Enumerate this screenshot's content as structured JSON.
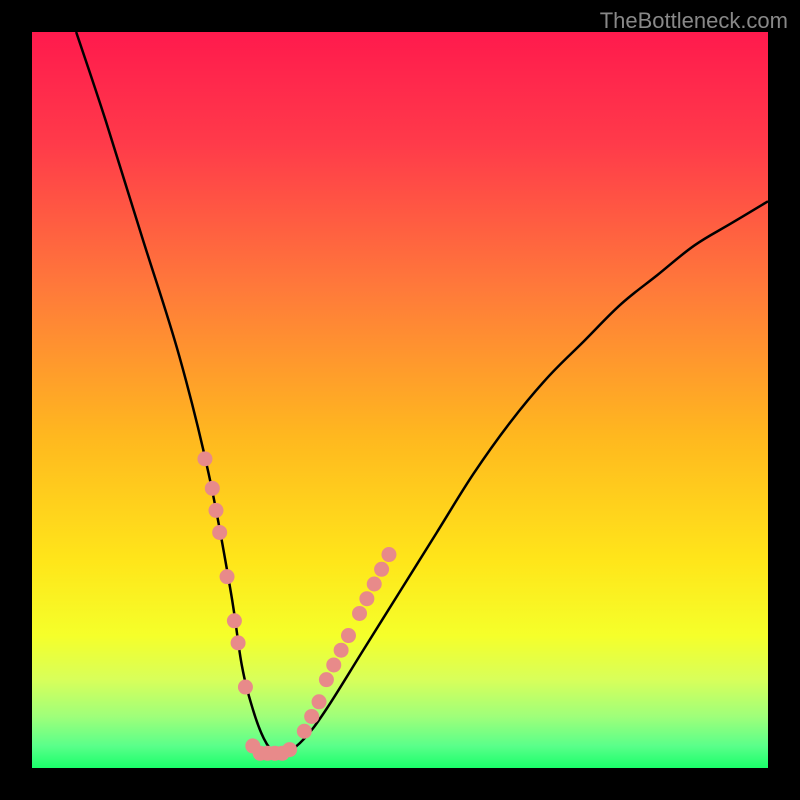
{
  "watermark": "TheBottleneck.com",
  "chart_data": {
    "type": "line",
    "title": "",
    "xlabel": "",
    "ylabel": "",
    "xlim": [
      0,
      100
    ],
    "ylim": [
      0,
      100
    ],
    "series": [
      {
        "name": "bottleneck-curve",
        "x": [
          6,
          10,
          15,
          20,
          24,
          27,
          28.5,
          30,
          31.5,
          33,
          34.5,
          37,
          40,
          45,
          50,
          55,
          60,
          65,
          70,
          75,
          80,
          85,
          90,
          95,
          100
        ],
        "y": [
          100,
          88,
          72,
          56,
          40,
          24,
          14,
          8,
          4,
          2,
          2,
          4,
          8,
          16,
          24,
          32,
          40,
          47,
          53,
          58,
          63,
          67,
          71,
          74,
          77
        ]
      }
    ],
    "markers": {
      "name": "highlight-dots",
      "color": "#e88a8a",
      "points": [
        {
          "x": 23.5,
          "y": 42
        },
        {
          "x": 24.5,
          "y": 38
        },
        {
          "x": 25,
          "y": 35
        },
        {
          "x": 25.5,
          "y": 32
        },
        {
          "x": 26.5,
          "y": 26
        },
        {
          "x": 27.5,
          "y": 20
        },
        {
          "x": 28,
          "y": 17
        },
        {
          "x": 29,
          "y": 11
        },
        {
          "x": 30,
          "y": 3
        },
        {
          "x": 31,
          "y": 2
        },
        {
          "x": 32,
          "y": 2
        },
        {
          "x": 33,
          "y": 2
        },
        {
          "x": 34,
          "y": 2
        },
        {
          "x": 35,
          "y": 2.5
        },
        {
          "x": 37,
          "y": 5
        },
        {
          "x": 38,
          "y": 7
        },
        {
          "x": 39,
          "y": 9
        },
        {
          "x": 40,
          "y": 12
        },
        {
          "x": 41,
          "y": 14
        },
        {
          "x": 42,
          "y": 16
        },
        {
          "x": 43,
          "y": 18
        },
        {
          "x": 44.5,
          "y": 21
        },
        {
          "x": 45.5,
          "y": 23
        },
        {
          "x": 46.5,
          "y": 25
        },
        {
          "x": 47.5,
          "y": 27
        },
        {
          "x": 48.5,
          "y": 29
        }
      ]
    },
    "gradient_stops": [
      {
        "offset": 0,
        "color": "#ff1a4d"
      },
      {
        "offset": 0.15,
        "color": "#ff3a4a"
      },
      {
        "offset": 0.35,
        "color": "#ff7a3a"
      },
      {
        "offset": 0.55,
        "color": "#ffb81f"
      },
      {
        "offset": 0.72,
        "color": "#ffe61a"
      },
      {
        "offset": 0.82,
        "color": "#f5ff2a"
      },
      {
        "offset": 0.88,
        "color": "#d8ff5a"
      },
      {
        "offset": 0.93,
        "color": "#9fff7a"
      },
      {
        "offset": 0.97,
        "color": "#5aff8a"
      },
      {
        "offset": 1,
        "color": "#1aff6a"
      }
    ]
  }
}
